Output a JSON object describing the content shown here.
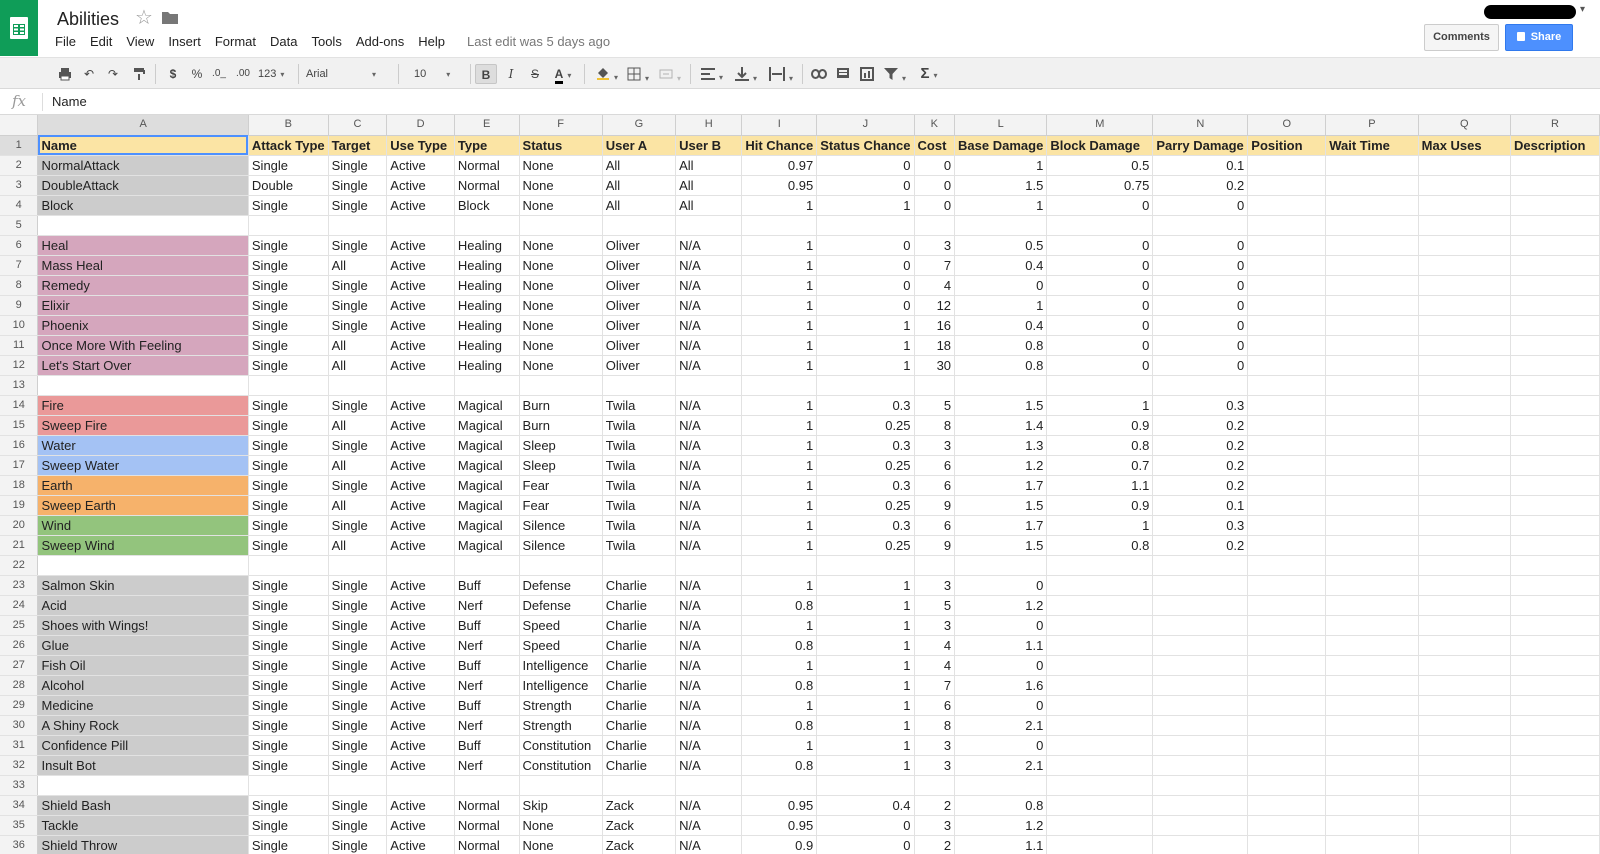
{
  "app": {
    "doc_title": "Abilities",
    "menu": [
      "File",
      "Edit",
      "View",
      "Insert",
      "Format",
      "Data",
      "Tools",
      "Add-ons",
      "Help"
    ],
    "last_edit": "Last edit was 5 days ago",
    "comments_label": "Comments",
    "share_label": "Share"
  },
  "toolbar": {
    "currency": "$",
    "percent": "%",
    "dec_decrease": ".0_",
    "dec_increase": ".00",
    "number_format": "123",
    "font": "Arial",
    "font_size": "10",
    "bold": "B",
    "italic": "I",
    "strike": "S",
    "text_color": "A",
    "functions": "Σ"
  },
  "formula_bar": {
    "fx": "fx",
    "value": "Name"
  },
  "colors": {
    "brand": "#0f9d58",
    "header_row": "#fbe4a4",
    "gray": "#cccccc",
    "pink": "#d5a6bd",
    "red": "#ea9999",
    "blue": "#a4c2f4",
    "orange": "#f6b26b",
    "green": "#93c47d",
    "selection": "#4d90fe"
  },
  "grid": {
    "columns": [
      "A",
      "B",
      "C",
      "D",
      "E",
      "F",
      "G",
      "H",
      "I",
      "J",
      "K",
      "L",
      "M",
      "N",
      "O",
      "P",
      "Q",
      "R"
    ],
    "rows": [
      {
        "n": "1",
        "fill": "header",
        "cells": [
          "Name",
          "Attack Type",
          "Target",
          "Use Type",
          "Type",
          "Status",
          "User A",
          "User B",
          "Hit Chance",
          "Status Chance",
          "Cost",
          "Base Damage",
          "Block Damage",
          "Parry Damage",
          "Position",
          "Wait Time",
          "Max Uses",
          "Description"
        ]
      },
      {
        "n": "2",
        "fill": "gray",
        "cells": [
          "NormalAttack",
          "Single",
          "Single",
          "Active",
          "Normal",
          "None",
          "All",
          "All",
          "0.97",
          "0",
          "0",
          "1",
          "0.5",
          "0.1",
          "",
          "",
          "",
          ""
        ]
      },
      {
        "n": "3",
        "fill": "gray",
        "cells": [
          "DoubleAttack",
          "Double",
          "Single",
          "Active",
          "Normal",
          "None",
          "All",
          "All",
          "0.95",
          "0",
          "0",
          "1.5",
          "0.75",
          "0.2",
          "",
          "",
          "",
          ""
        ]
      },
      {
        "n": "4",
        "fill": "gray",
        "cells": [
          "Block",
          "Single",
          "Single",
          "Active",
          "Block",
          "None",
          "All",
          "All",
          "1",
          "1",
          "0",
          "1",
          "0",
          "0",
          "",
          "",
          "",
          ""
        ]
      },
      {
        "n": "5",
        "fill": "",
        "cells": [
          "",
          "",
          "",
          "",
          "",
          "",
          "",
          "",
          "",
          "",
          "",
          "",
          "",
          "",
          "",
          "",
          "",
          ""
        ]
      },
      {
        "n": "6",
        "fill": "pink",
        "cells": [
          "Heal",
          "Single",
          "Single",
          "Active",
          "Healing",
          "None",
          "Oliver",
          "N/A",
          "1",
          "0",
          "3",
          "0.5",
          "0",
          "0",
          "",
          "",
          "",
          ""
        ]
      },
      {
        "n": "7",
        "fill": "pink",
        "cells": [
          "Mass Heal",
          "Single",
          "All",
          "Active",
          "Healing",
          "None",
          "Oliver",
          "N/A",
          "1",
          "0",
          "7",
          "0.4",
          "0",
          "0",
          "",
          "",
          "",
          ""
        ]
      },
      {
        "n": "8",
        "fill": "pink",
        "cells": [
          "Remedy",
          "Single",
          "Single",
          "Active",
          "Healing",
          "None",
          "Oliver",
          "N/A",
          "1",
          "0",
          "4",
          "0",
          "0",
          "0",
          "",
          "",
          "",
          ""
        ]
      },
      {
        "n": "9",
        "fill": "pink",
        "cells": [
          "Elixir",
          "Single",
          "Single",
          "Active",
          "Healing",
          "None",
          "Oliver",
          "N/A",
          "1",
          "0",
          "12",
          "1",
          "0",
          "0",
          "",
          "",
          "",
          ""
        ]
      },
      {
        "n": "10",
        "fill": "pink",
        "cells": [
          "Phoenix",
          "Single",
          "Single",
          "Active",
          "Healing",
          "None",
          "Oliver",
          "N/A",
          "1",
          "1",
          "16",
          "0.4",
          "0",
          "0",
          "",
          "",
          "",
          ""
        ]
      },
      {
        "n": "11",
        "fill": "pink",
        "cells": [
          "Once More With Feeling",
          "Single",
          "All",
          "Active",
          "Healing",
          "None",
          "Oliver",
          "N/A",
          "1",
          "1",
          "18",
          "0.8",
          "0",
          "0",
          "",
          "",
          "",
          ""
        ]
      },
      {
        "n": "12",
        "fill": "pink",
        "cells": [
          "Let's Start Over",
          "Single",
          "All",
          "Active",
          "Healing",
          "None",
          "Oliver",
          "N/A",
          "1",
          "1",
          "30",
          "0.8",
          "0",
          "0",
          "",
          "",
          "",
          ""
        ]
      },
      {
        "n": "13",
        "fill": "",
        "cells": [
          "",
          "",
          "",
          "",
          "",
          "",
          "",
          "",
          "",
          "",
          "",
          "",
          "",
          "",
          "",
          "",
          "",
          ""
        ]
      },
      {
        "n": "14",
        "fill": "red",
        "cells": [
          "Fire",
          "Single",
          "Single",
          "Active",
          "Magical",
          "Burn",
          "Twila",
          "N/A",
          "1",
          "0.3",
          "5",
          "1.5",
          "1",
          "0.3",
          "",
          "",
          "",
          ""
        ]
      },
      {
        "n": "15",
        "fill": "red",
        "cells": [
          "Sweep Fire",
          "Single",
          "All",
          "Active",
          "Magical",
          "Burn",
          "Twila",
          "N/A",
          "1",
          "0.25",
          "8",
          "1.4",
          "0.9",
          "0.2",
          "",
          "",
          "",
          ""
        ]
      },
      {
        "n": "16",
        "fill": "blue",
        "cells": [
          "Water",
          "Single",
          "Single",
          "Active",
          "Magical",
          "Sleep",
          "Twila",
          "N/A",
          "1",
          "0.3",
          "3",
          "1.3",
          "0.8",
          "0.2",
          "",
          "",
          "",
          ""
        ]
      },
      {
        "n": "17",
        "fill": "blue",
        "cells": [
          "Sweep Water",
          "Single",
          "All",
          "Active",
          "Magical",
          "Sleep",
          "Twila",
          "N/A",
          "1",
          "0.25",
          "6",
          "1.2",
          "0.7",
          "0.2",
          "",
          "",
          "",
          ""
        ]
      },
      {
        "n": "18",
        "fill": "orange",
        "cells": [
          "Earth",
          "Single",
          "Single",
          "Active",
          "Magical",
          "Fear",
          "Twila",
          "N/A",
          "1",
          "0.3",
          "6",
          "1.7",
          "1.1",
          "0.2",
          "",
          "",
          "",
          ""
        ]
      },
      {
        "n": "19",
        "fill": "orange",
        "cells": [
          "Sweep Earth",
          "Single",
          "All",
          "Active",
          "Magical",
          "Fear",
          "Twila",
          "N/A",
          "1",
          "0.25",
          "9",
          "1.5",
          "0.9",
          "0.1",
          "",
          "",
          "",
          ""
        ]
      },
      {
        "n": "20",
        "fill": "green",
        "cells": [
          "Wind",
          "Single",
          "Single",
          "Active",
          "Magical",
          "Silence",
          "Twila",
          "N/A",
          "1",
          "0.3",
          "6",
          "1.7",
          "1",
          "0.3",
          "",
          "",
          "",
          ""
        ]
      },
      {
        "n": "21",
        "fill": "green",
        "cells": [
          "Sweep Wind",
          "Single",
          "All",
          "Active",
          "Magical",
          "Silence",
          "Twila",
          "N/A",
          "1",
          "0.25",
          "9",
          "1.5",
          "0.8",
          "0.2",
          "",
          "",
          "",
          ""
        ]
      },
      {
        "n": "22",
        "fill": "",
        "cells": [
          "",
          "",
          "",
          "",
          "",
          "",
          "",
          "",
          "",
          "",
          "",
          "",
          "",
          "",
          "",
          "",
          "",
          ""
        ]
      },
      {
        "n": "23",
        "fill": "gray",
        "cells": [
          "Salmon Skin",
          "Single",
          "Single",
          "Active",
          "Buff",
          "Defense",
          "Charlie",
          "N/A",
          "1",
          "1",
          "3",
          "0",
          "",
          "",
          "",
          "",
          "",
          ""
        ]
      },
      {
        "n": "24",
        "fill": "gray",
        "cells": [
          "Acid",
          "Single",
          "Single",
          "Active",
          "Nerf",
          "Defense",
          "Charlie",
          "N/A",
          "0.8",
          "1",
          "5",
          "1.2",
          "",
          "",
          "",
          "",
          "",
          ""
        ]
      },
      {
        "n": "25",
        "fill": "gray",
        "cells": [
          "Shoes with Wings!",
          "Single",
          "Single",
          "Active",
          "Buff",
          "Speed",
          "Charlie",
          "N/A",
          "1",
          "1",
          "3",
          "0",
          "",
          "",
          "",
          "",
          "",
          ""
        ]
      },
      {
        "n": "26",
        "fill": "gray",
        "cells": [
          "Glue",
          "Single",
          "Single",
          "Active",
          "Nerf",
          "Speed",
          "Charlie",
          "N/A",
          "0.8",
          "1",
          "4",
          "1.1",
          "",
          "",
          "",
          "",
          "",
          ""
        ]
      },
      {
        "n": "27",
        "fill": "gray",
        "cells": [
          "Fish Oil",
          "Single",
          "Single",
          "Active",
          "Buff",
          "Intelligence",
          "Charlie",
          "N/A",
          "1",
          "1",
          "4",
          "0",
          "",
          "",
          "",
          "",
          "",
          ""
        ]
      },
      {
        "n": "28",
        "fill": "gray",
        "cells": [
          "Alcohol",
          "Single",
          "Single",
          "Active",
          "Nerf",
          "Intelligence",
          "Charlie",
          "N/A",
          "0.8",
          "1",
          "7",
          "1.6",
          "",
          "",
          "",
          "",
          "",
          ""
        ]
      },
      {
        "n": "29",
        "fill": "gray",
        "cells": [
          "Medicine",
          "Single",
          "Single",
          "Active",
          "Buff",
          "Strength",
          "Charlie",
          "N/A",
          "1",
          "1",
          "6",
          "0",
          "",
          "",
          "",
          "",
          "",
          ""
        ]
      },
      {
        "n": "30",
        "fill": "gray",
        "cells": [
          "A Shiny Rock",
          "Single",
          "Single",
          "Active",
          "Nerf",
          "Strength",
          "Charlie",
          "N/A",
          "0.8",
          "1",
          "8",
          "2.1",
          "",
          "",
          "",
          "",
          "",
          ""
        ]
      },
      {
        "n": "31",
        "fill": "gray",
        "cells": [
          "Confidence Pill",
          "Single",
          "Single",
          "Active",
          "Buff",
          "Constitution",
          "Charlie",
          "N/A",
          "1",
          "1",
          "3",
          "0",
          "",
          "",
          "",
          "",
          "",
          ""
        ]
      },
      {
        "n": "32",
        "fill": "gray",
        "cells": [
          "Insult Bot",
          "Single",
          "Single",
          "Active",
          "Nerf",
          "Constitution",
          "Charlie",
          "N/A",
          "0.8",
          "1",
          "3",
          "2.1",
          "",
          "",
          "",
          "",
          "",
          ""
        ]
      },
      {
        "n": "33",
        "fill": "",
        "cells": [
          "",
          "",
          "",
          "",
          "",
          "",
          "",
          "",
          "",
          "",
          "",
          "",
          "",
          "",
          "",
          "",
          "",
          ""
        ]
      },
      {
        "n": "34",
        "fill": "gray",
        "cells": [
          "Shield Bash",
          "Single",
          "Single",
          "Active",
          "Normal",
          "Skip",
          "Zack",
          "N/A",
          "0.95",
          "0.4",
          "2",
          "0.8",
          "",
          "",
          "",
          "",
          "",
          ""
        ]
      },
      {
        "n": "35",
        "fill": "gray",
        "cells": [
          "Tackle",
          "Single",
          "Single",
          "Active",
          "Normal",
          "None",
          "Zack",
          "N/A",
          "0.95",
          "0",
          "3",
          "1.2",
          "",
          "",
          "",
          "",
          "",
          ""
        ]
      },
      {
        "n": "36",
        "fill": "gray",
        "cells": [
          "Shield Throw",
          "Single",
          "Single",
          "Active",
          "Normal",
          "None",
          "Zack",
          "N/A",
          "0.9",
          "0",
          "2",
          "1.1",
          "",
          "",
          "",
          "",
          "",
          ""
        ]
      }
    ]
  }
}
